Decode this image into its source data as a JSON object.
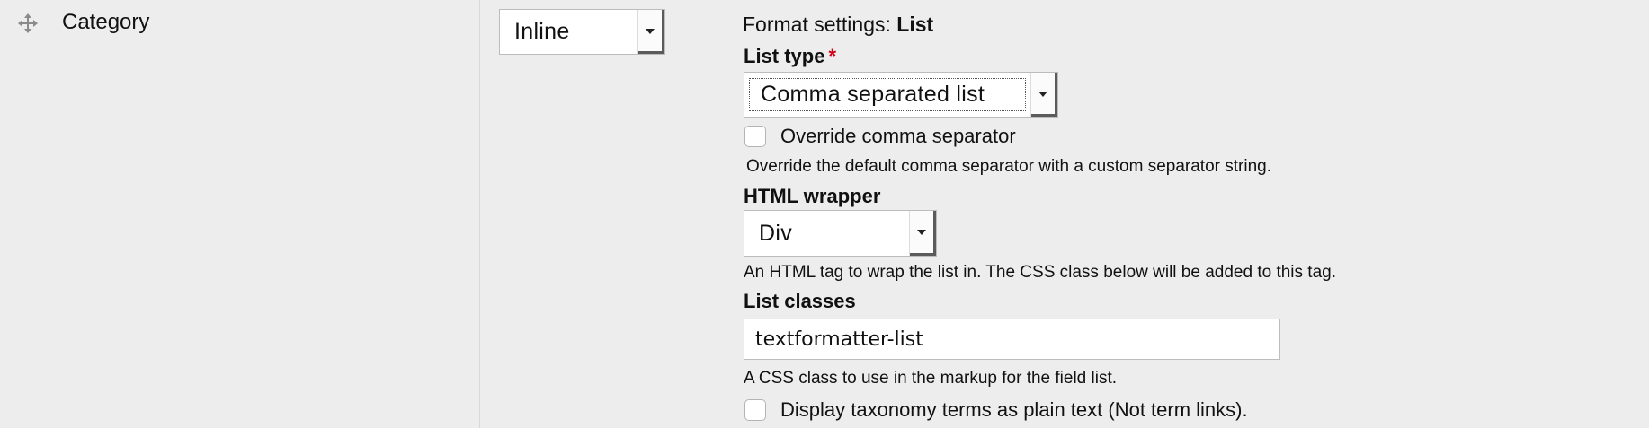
{
  "row": {
    "field_label": "Category",
    "drag_icon": "move-cross-icon"
  },
  "label_display": {
    "selected": "Inline"
  },
  "format": {
    "heading_prefix": "Format settings: ",
    "heading_name": "List",
    "list_type": {
      "label": "List type",
      "required_mark": "*",
      "selected": "Comma separated list"
    },
    "override_separator": {
      "label": "Override comma separator",
      "checked": false,
      "description": "Override the default comma separator with a custom separator string."
    },
    "html_wrapper": {
      "label": "HTML wrapper",
      "selected": "Div",
      "description": "An HTML tag to wrap the list in. The CSS class below will be added to this tag."
    },
    "list_classes": {
      "label": "List classes",
      "value": "textformatter-list",
      "description": "A CSS class to use in the markup for the field list."
    },
    "plain_text_terms": {
      "label": "Display taxonomy terms as plain text (Not term links).",
      "checked": false
    }
  },
  "colors": {
    "background": "#ededed",
    "required": "#d0021b"
  }
}
